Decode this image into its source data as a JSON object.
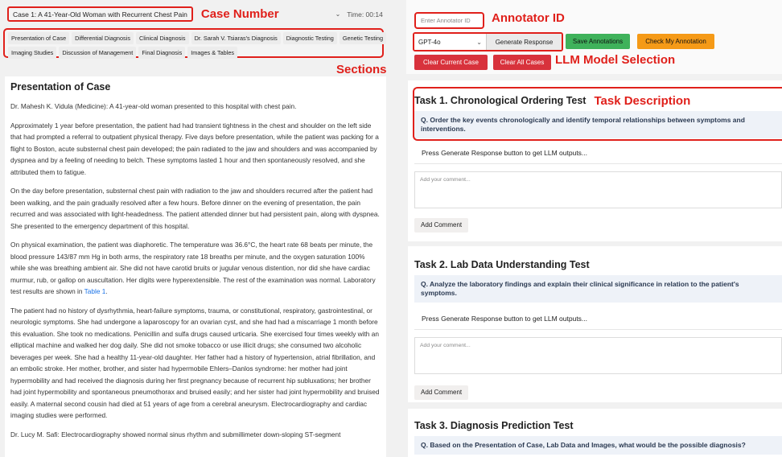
{
  "header": {
    "case_select": "Case 1: A 41-Year-Old Woman with Recurrent Chest Pain",
    "case_number_label": "Case Number",
    "timer": "Time: 00:14"
  },
  "sections": {
    "label": "Sections",
    "tabs_row1": [
      "Presentation of Case",
      "Differential Diagnosis",
      "Clinical Diagnosis",
      "Dr. Sarah V. Tsiaras's Diagnosis",
      "Diagnostic Testing",
      "Genetic Testing"
    ],
    "tabs_row2": [
      "Imaging Studies",
      "Discussion of Management",
      "Final Diagnosis",
      "Images & Tables"
    ]
  },
  "content": {
    "title": "Presentation of Case",
    "paragraphs": [
      "Dr. Mahesh K. Vidula (Medicine): A 41-year-old woman presented to this hospital with chest pain.",
      "Approximately 1 year before presentation, the patient had had transient tightness in the chest and shoulder on the left side that had prompted a referral to outpatient physical therapy. Five days before presentation, while the patient was packing for a flight to Boston, acute substernal chest pain developed; the pain radiated to the jaw and shoulders and was accompanied by dyspnea and by a feeling of needing to belch. These symptoms lasted 1 hour and then spontaneously resolved, and she attributed them to fatigue.",
      "On the day before presentation, substernal chest pain with radiation to the jaw and shoulders recurred after the patient had been walking, and the pain gradually resolved after a few hours. Before dinner on the evening of presentation, the pain recurred and was associated with light-headedness. The patient attended dinner but had persistent pain, along with dyspnea. She presented to the emergency department of this hospital.",
      "The patient had no history of dysrhythmia, heart-failure symptoms, trauma, or constitutional, respiratory, gastrointestinal, or neurologic symptoms. She had undergone a laparoscopy for an ovarian cyst, and she had had a miscarriage 1 month before this evaluation. She took no medications. Penicillin and sulfa drugs caused urticaria. She exercised four times weekly with an elliptical machine and walked her dog daily. She did not smoke tobacco or use illicit drugs; she consumed two alcoholic beverages per week. She had a healthy 11-year-old daughter. Her father had a history of hypertension, atrial fibrillation, and an embolic stroke. Her mother, brother, and sister had hypermobile Ehlers–Danlos syndrome: her mother had joint hypermobility and had received the diagnosis during her first pregnancy because of recurrent hip subluxations; her brother had joint hypermobility and spontaneous pneumothorax and bruised easily; and her sister had joint hypermobility and bruised easily. A maternal second cousin had died at 51 years of age from a cerebral aneurysm. Electrocardiography and cardiac imaging studies were performed.",
      "Dr. Lucy M. Safi: Electrocardiography showed normal sinus rhythm and submillimeter down-sloping ST-segment"
    ],
    "exam_paragraph_main": "On physical examination, the patient was diaphoretic. The temperature was 36.6°C, the heart rate 68 beats per minute, the blood pressure 143/87 mm Hg in both arms, the respiratory rate 18 breaths per minute, and the oxygen saturation 100% while she was breathing ambient air. She did not have carotid bruits or jugular venous distention, nor did she have cardiac murmur, rub, or gallop on auscultation. Her digits were hyperextensible. The rest of the examination was normal. Laboratory test results are shown in ",
    "exam_paragraph_link": "Table 1",
    "exam_paragraph_end": "."
  },
  "annotator": {
    "placeholder": "Enter Annotator ID",
    "label": "Annotator ID"
  },
  "model": {
    "selected": "GPT-4o",
    "label": "LLM Model Selection"
  },
  "buttons": {
    "generate": "Generate Response",
    "save": "Save Annotations",
    "check": "Check My Annotation",
    "clear_current": "Clear Current Case",
    "clear_all": "Clear All Cases"
  },
  "tasks": [
    {
      "title": "Task 1. Chronological Ordering Test",
      "annotation_label": "Task Description",
      "question": "Q. Order the key events chronologically and identify temporal relationships between symptoms and interventions.",
      "response": "Press Generate Response button to get LLM outputs...",
      "comment_placeholder": "Add your comment...",
      "add_comment": "Add Comment"
    },
    {
      "title": "Task 2. Lab Data Understanding Test",
      "question": "Q. Analyze the laboratory findings and explain their clinical significance in relation to the patient's symptoms.",
      "response": "Press Generate Response button to get LLM outputs...",
      "comment_placeholder": "Add your comment...",
      "add_comment": "Add Comment"
    },
    {
      "title": "Task 3. Diagnosis Prediction Test",
      "question": "Q. Based on the Presentation of Case, Lab Data and Images, what would be the possible diagnosis?"
    }
  ],
  "colors": {
    "annotation_red": "#e0201b",
    "save_green": "#3fb25b",
    "check_orange": "#f59a17",
    "clear_red": "#d8323c",
    "link_blue": "#1a73e8"
  }
}
